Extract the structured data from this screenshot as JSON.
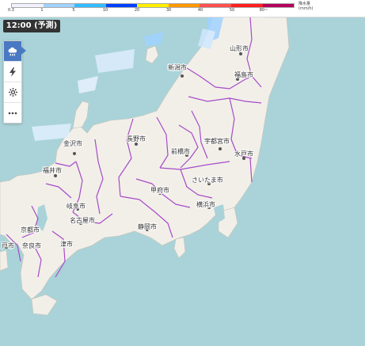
{
  "legend": {
    "ticks": [
      "0.3",
      "1",
      "5",
      "10",
      "20",
      "30",
      "40",
      "50",
      "80~"
    ],
    "title_line1": "降水量",
    "title_line2": "(mm/h)",
    "colors": [
      "#f2f2ff",
      "#a0d2ff",
      "#33bcff",
      "#0041ff",
      "#fff000",
      "#ff9900",
      "#ff5050",
      "#ff1e1e",
      "#b3005a"
    ]
  },
  "time_badge": "12:00 (予測)",
  "controls": [
    {
      "icon": "rain-cloud-icon",
      "active": true
    },
    {
      "icon": "lightning-icon",
      "active": false
    },
    {
      "icon": "gear-icon",
      "active": false
    },
    {
      "icon": "more-icon",
      "active": false
    }
  ],
  "map": {
    "sea_color": "#a9d3d8",
    "land_color": "#f2efe9",
    "boundary_color": "#a64bc8",
    "cities": [
      "山形市",
      "新潟市",
      "福島市",
      "金沢市",
      "長野市",
      "宇都宮市",
      "前橋市",
      "水戸市",
      "福井市",
      "さいたま市",
      "甲府市",
      "岐阜市",
      "横浜市",
      "名古屋市",
      "静岡市",
      "京都市",
      "戸市",
      "奈良市",
      "津市"
    ]
  }
}
